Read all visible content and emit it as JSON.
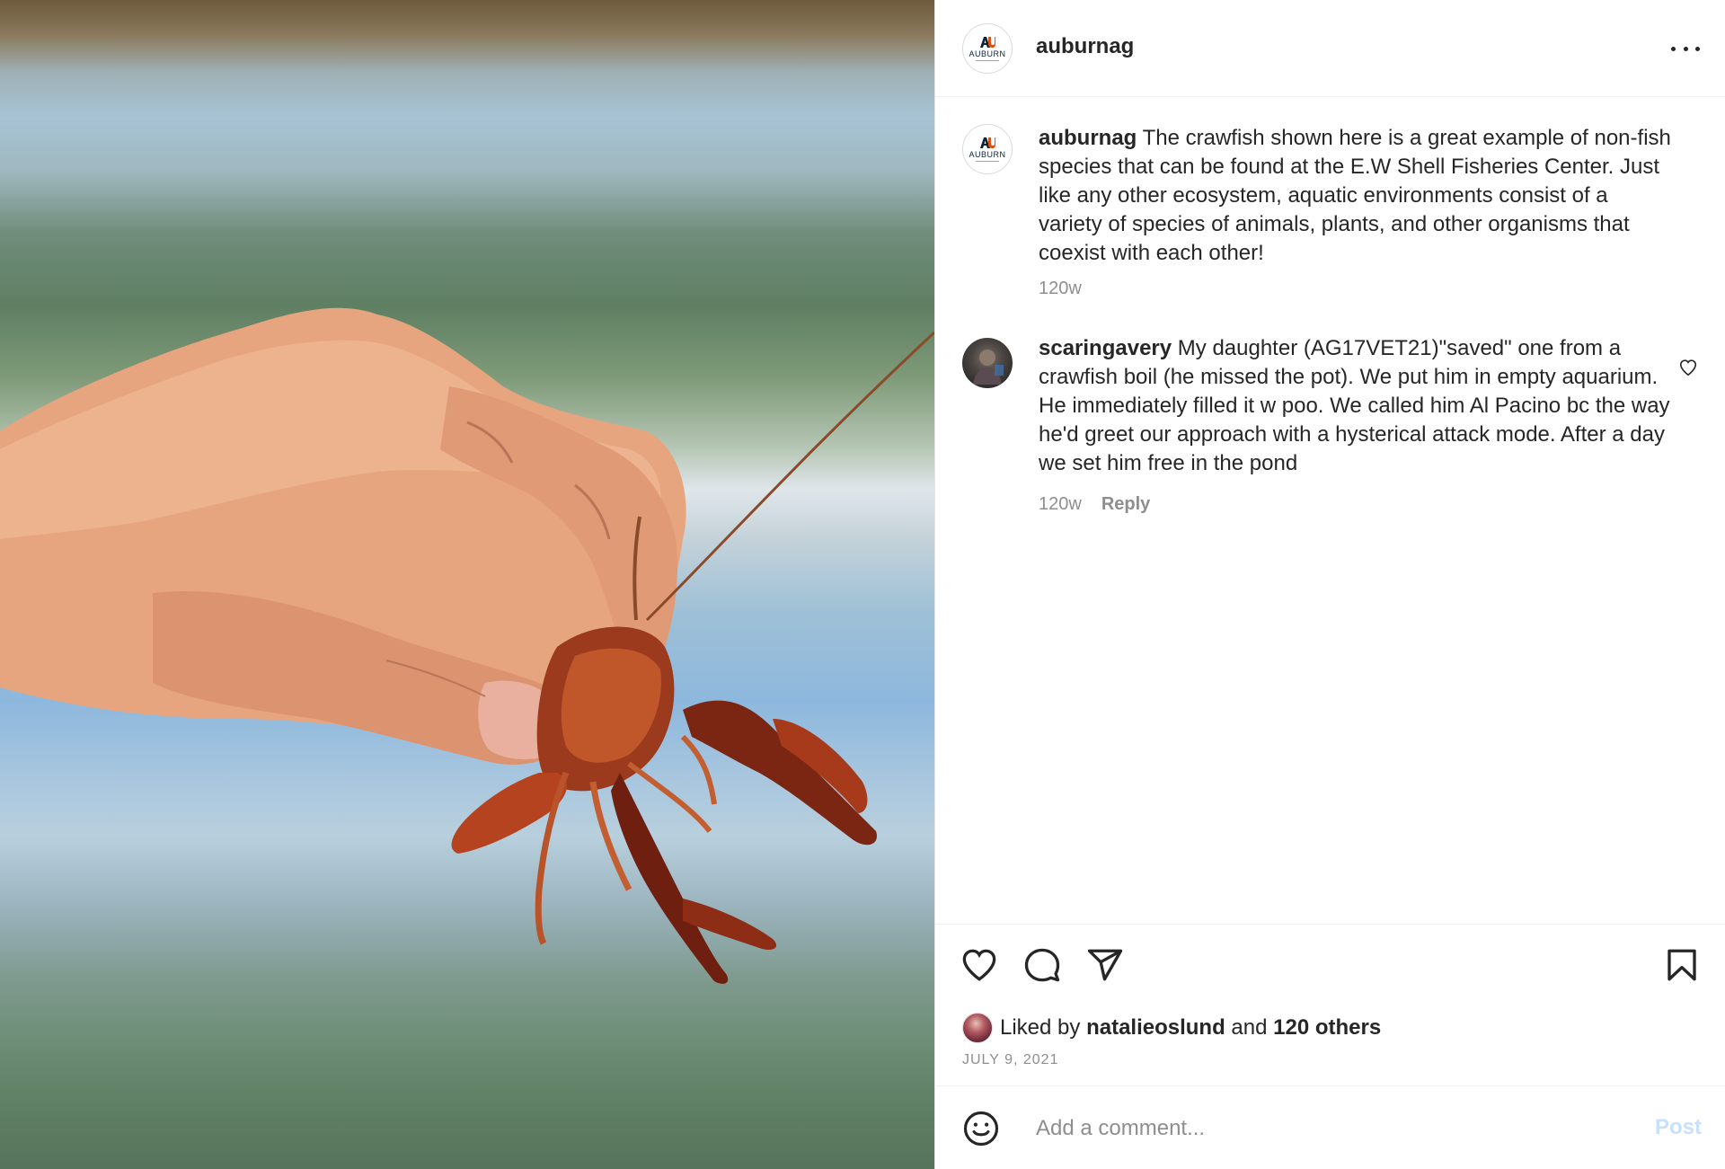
{
  "photo": {
    "alt_subject": "hand holding crawfish"
  },
  "header": {
    "username": "auburnag",
    "avatar_text": "AUBURN"
  },
  "caption": {
    "username": "auburnag",
    "text": "The crawfish shown here is a great example of non-fish species that can be found at the E.W Shell Fisheries Center. Just like any other ecosystem, aquatic environments consist of a variety of species of animals, plants, and other organisms that coexist with each other!",
    "time": "120w"
  },
  "comments": [
    {
      "username": "scaringavery",
      "text": "My daughter (AG17VET21)\"saved\" one from a crawfish boil (he missed the pot). We put him in empty aquarium. He immediately filled it w poo. We called him Al Pacino bc the way he'd greet our approach with a hysterical attack mode. After a day we set him free in the pond",
      "time": "120w",
      "reply_label": "Reply"
    }
  ],
  "likes": {
    "prefix": "Liked by",
    "first_user": "natalieoslund",
    "joiner": "and",
    "others": "120 others"
  },
  "date": "JULY 9, 2021",
  "add_comment": {
    "placeholder": "Add a comment...",
    "post_label": "Post"
  },
  "icons": {
    "like": "heart-icon",
    "comment": "comment-icon",
    "share": "send-icon",
    "save": "bookmark-icon",
    "emoji": "smiley-icon",
    "more": "more-icon"
  },
  "colors": {
    "text": "#262626",
    "secondary": "#8e8e8e",
    "post_button_disabled": "#c7e0fd",
    "border": "#efefef"
  }
}
